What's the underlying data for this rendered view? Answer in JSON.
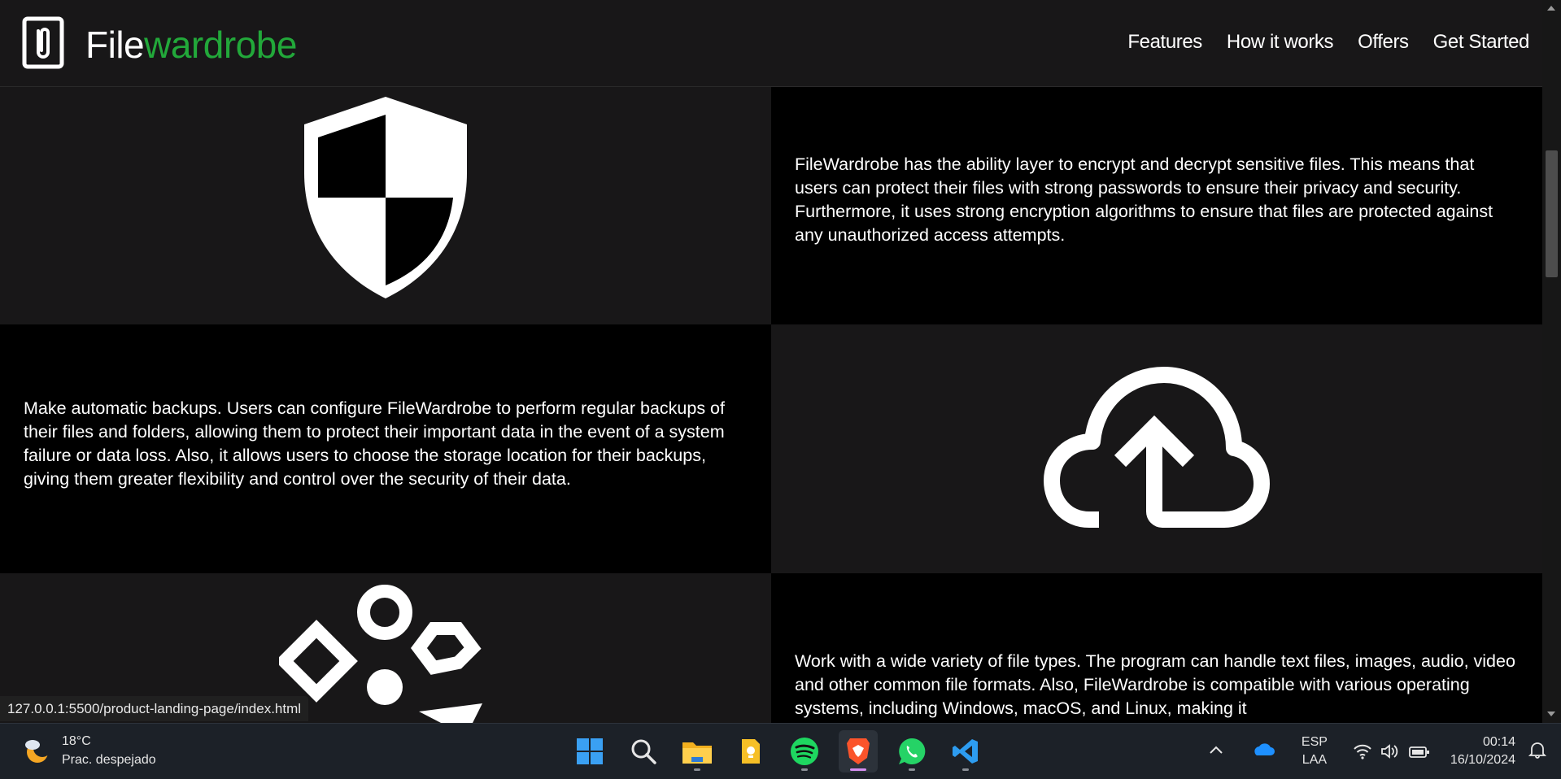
{
  "header": {
    "brand_part1": "File",
    "brand_part2": "wardrobe",
    "nav": [
      "Features",
      "How it works",
      "Offers",
      "Get Started"
    ]
  },
  "features": [
    {
      "icon": "shield-icon",
      "text": "FileWardrobe has the ability layer to encrypt and decrypt sensitive files. This means that users can protect their files with strong passwords to ensure their privacy and security. Furthermore, it uses strong encryption algorithms to ensure that files are protected against any unauthorized access attempts."
    },
    {
      "icon": "cloud-upload-icon",
      "text": "Make automatic backups. Users can configure FileWardrobe to perform regular backups of their files and folders, allowing them to protect their important data in the event of a system failure or data loss. Also, it allows users to choose the storage location for their backups, giving them greater flexibility and control over the security of their data."
    },
    {
      "icon": "shapes-icon",
      "text": "Work with a wide variety of file types. The program can handle text files, images, audio, video and other common file formats. Also, FileWardrobe is compatible with various operating systems, including Windows, macOS, and Linux, making it"
    }
  ],
  "status_url": "127.0.0.1:5500/product-landing-page/index.html",
  "taskbar": {
    "weather_temp": "18°C",
    "weather_desc": "Prac. despejado",
    "apps": [
      "windows-start-icon",
      "search-icon",
      "file-explorer-icon",
      "keep-notes-icon",
      "spotify-icon",
      "brave-browser-icon",
      "whatsapp-icon",
      "vscode-icon"
    ],
    "lang_1": "ESP",
    "lang_2": "LAA",
    "time": "00:14",
    "date": "16/10/2024"
  },
  "colors": {
    "brand_green": "#22a83a",
    "header_bg": "#181718",
    "panel_dark": "#181718",
    "panel_black": "#000000"
  }
}
